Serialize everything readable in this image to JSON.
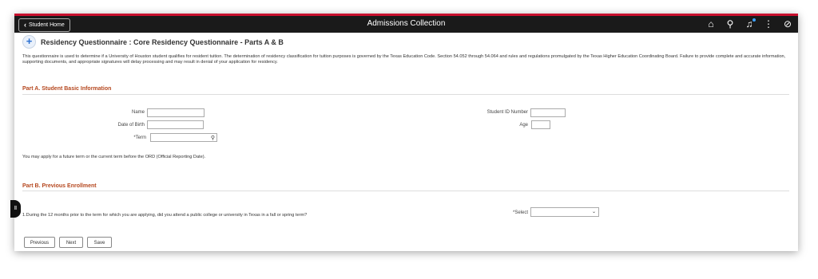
{
  "topbar": {
    "back_label": "Student Home",
    "title": "Admissions Collection",
    "icons": [
      "home-icon",
      "search-icon",
      "bell-icon",
      "more-vert-icon",
      "compass-icon"
    ]
  },
  "header": {
    "title": "Residency Questionnaire :  Core Residency Questionnaire - Parts A & B",
    "icon": "plus-circle-icon"
  },
  "intro_text": "This questionnaire is used to determine if a University of Houston student qualifies for resident tuition. The determination of residency classification for tuition purposes is governed by the Texas Education Code. Section 54.052 through 54.064 and rules and regulations promulgated by the Texas Higher Education Coordinating Board. Failure to provide complete and accurate information, supporting documents, and appropriate signatures will delay processing and may result in denial of your application for residency.",
  "part_a": {
    "title": "Part A. Student Basic Information",
    "name_label": "Name",
    "dob_label": "Date of Birth",
    "term_label": "*Term",
    "student_id_label": "Student ID Number",
    "age_label": "Age",
    "name_value": "",
    "dob_value": "",
    "term_value": "",
    "student_id_value": "",
    "age_value": "",
    "note": "You may apply for a future term or the current term before the ORD (Official Reporting Date)."
  },
  "part_b": {
    "title": "Part B. Previous Enrollment",
    "question": "1.During the 12 months prior to the term for which you are applying, did you attend a public college or university in Texas in a fall or spring term?",
    "select_label": "*Select",
    "select_value": ""
  },
  "buttons": {
    "previous": "Previous",
    "next": "Next",
    "save": "Save"
  },
  "colors": {
    "accent": "#c8102e",
    "section_title": "#b5471e",
    "topbar": "#1a1a1a"
  }
}
